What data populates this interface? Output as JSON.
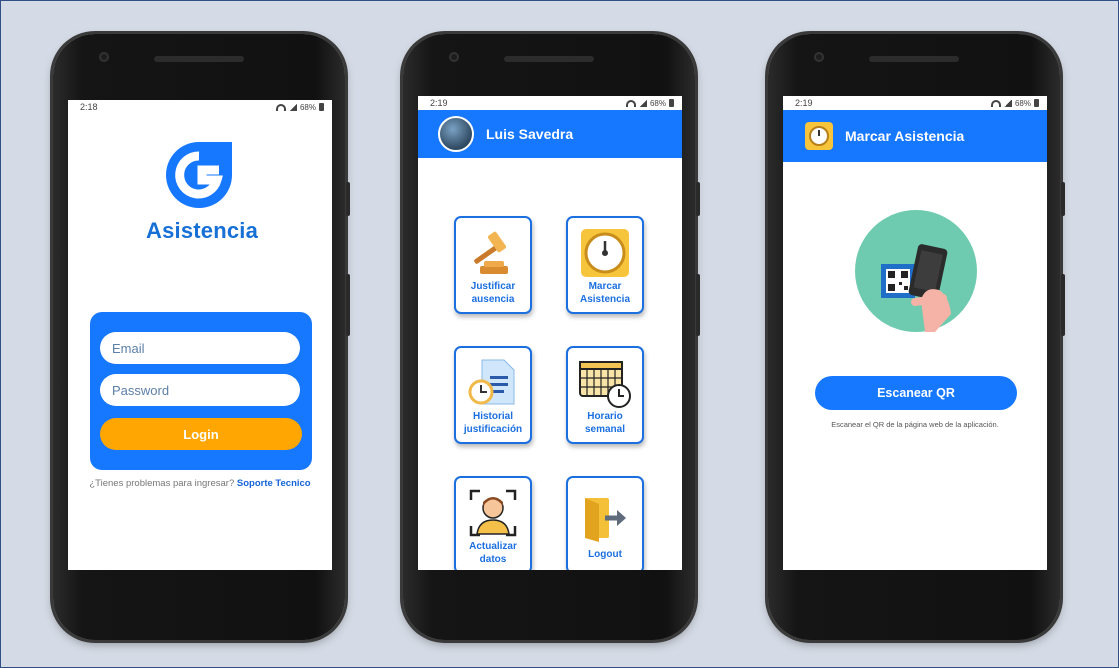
{
  "phone1": {
    "status_time": "2:18",
    "battery": "68%",
    "logo_text": "Asistencia",
    "email_placeholder": "Email",
    "password_placeholder": "Password",
    "login_label": "Login",
    "help_text": "¿Tienes problemas para ingresar?",
    "support_link": "Soporte Tecnico"
  },
  "phone2": {
    "status_time": "2:19",
    "battery": "68%",
    "user_name": "Luis Savedra",
    "tiles": [
      {
        "line1": "Justificar",
        "line2": "ausencia"
      },
      {
        "line1": "Marcar",
        "line2": "Asistencia"
      },
      {
        "line1": "Historial",
        "line2": "justificación"
      },
      {
        "line1": "Horario",
        "line2": "semanal"
      },
      {
        "line1": "Actualizar",
        "line2": "datos"
      },
      {
        "line1": "Logout",
        "line2": ""
      }
    ]
  },
  "phone3": {
    "status_time": "2:19",
    "battery": "68%",
    "title": "Marcar Asistencia",
    "scan_label": "Escanear QR",
    "scan_hint": "Escanear el QR de la página web de la aplicación."
  },
  "colors": {
    "primary": "#1677ff",
    "accent": "#ffa602",
    "background": "#d5dbe6"
  }
}
